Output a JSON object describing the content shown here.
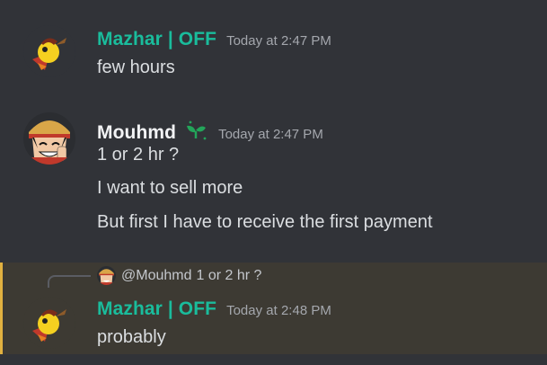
{
  "colors": {
    "background": "#313338",
    "mazhar_name": "#1abc9c",
    "mouhmd_name": "#f2f3f5",
    "text": "#dbdee1",
    "timestamp": "#a4a7ad",
    "highlight_bg": "#3d3a33",
    "highlight_bar": "#e1b140"
  },
  "messages": [
    {
      "author": "Mazhar | OFF",
      "timestamp": "Today at 2:47 PM",
      "avatar": "mazhar-avatar",
      "lines": [
        "few hours"
      ]
    },
    {
      "author": "Mouhmd",
      "badge": "sprout-badge-icon",
      "timestamp": "Today at 2:47 PM",
      "avatar": "mouhmd-avatar",
      "lines": [
        "1 or 2 hr ?",
        "I want to sell more",
        "But first I have to receive the first payment"
      ]
    },
    {
      "reply_to": {
        "mention": "@Mouhmd",
        "text": "1 or 2 hr ?"
      },
      "author": "Mazhar | OFF",
      "timestamp": "Today at 2:48 PM",
      "avatar": "mazhar-avatar",
      "lines": [
        "probably"
      ]
    }
  ]
}
